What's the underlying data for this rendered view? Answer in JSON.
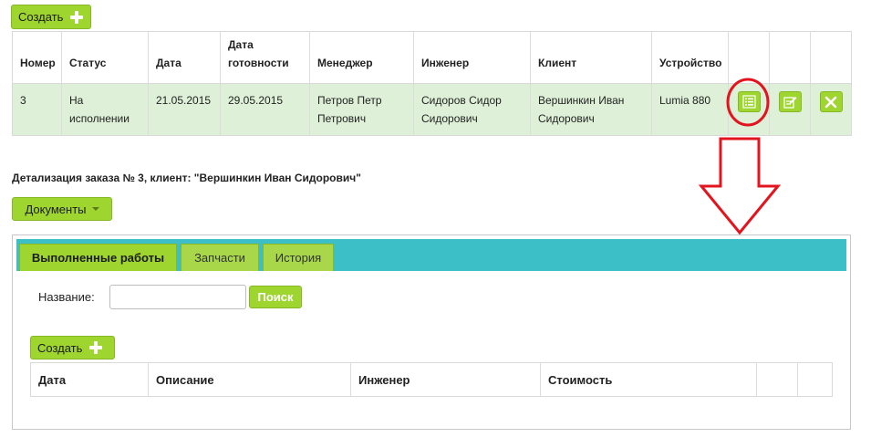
{
  "top_create": {
    "label": "Создать"
  },
  "orders": {
    "headers": [
      "Номер",
      "Статус",
      "Дата",
      "Дата готовности",
      "Менеджер",
      "Инженер",
      "Клиент",
      "Устройство"
    ],
    "row": {
      "number": "3",
      "status": "На исполнении",
      "date": "21.05.2015",
      "ready_date": "29.05.2015",
      "manager": "Петров Петр Петрович",
      "engineer": "Сидоров Сидор Сидорович",
      "client": "Вершинкин Иван Сидорович",
      "device": "Lumia 880"
    }
  },
  "details": {
    "title": "Детализация заказа № 3, клиент: \"Вершинкин Иван Сидорович\""
  },
  "documents_button": {
    "label": "Документы"
  },
  "tabs": [
    {
      "label": "Выполненные работы",
      "active": true
    },
    {
      "label": "Запчасти",
      "active": false
    },
    {
      "label": "История",
      "active": false
    }
  ],
  "search": {
    "label": "Название:",
    "value": "",
    "placeholder": "",
    "button": "Поиск"
  },
  "works_create": {
    "label": "Создать"
  },
  "works_table": {
    "headers": [
      "Дата",
      "Описание",
      "Инженер",
      "Стоимость"
    ]
  },
  "colors": {
    "accent_green": "#9fd52f",
    "row_highlight": "#dff0d8",
    "tab_bar": "#3cbfc7",
    "annotation_red": "#e2141d"
  },
  "icons": [
    "plus-icon",
    "details-list-icon",
    "edit-icon",
    "delete-icon",
    "caret-down-icon"
  ]
}
